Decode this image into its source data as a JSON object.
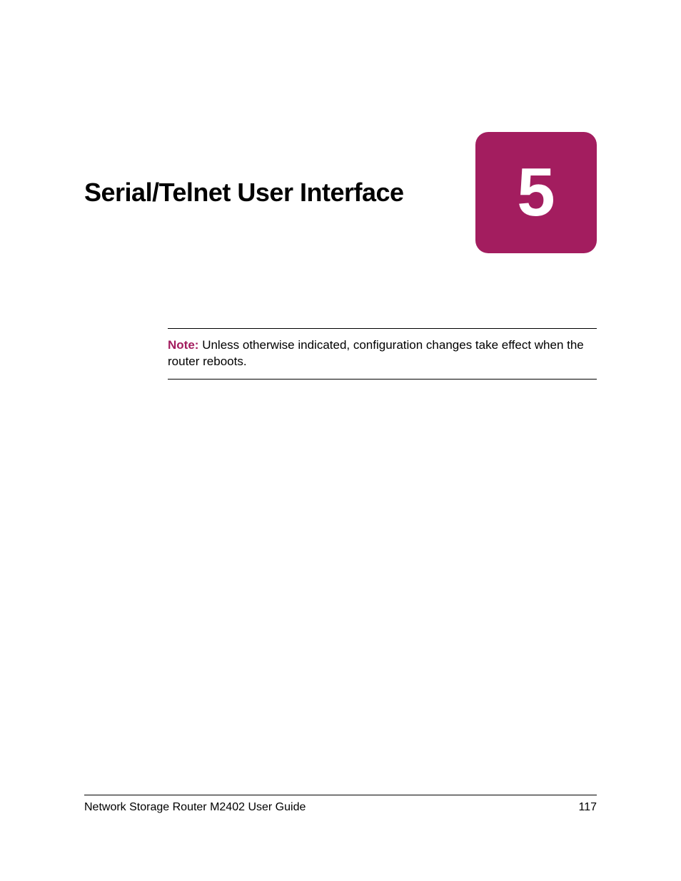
{
  "chapter": {
    "title": "Serial/Telnet User Interface",
    "number": "5"
  },
  "note": {
    "label": "Note:",
    "text": "Unless otherwise indicated, configuration changes take effect when the router reboots."
  },
  "footer": {
    "guide_title": "Network Storage Router M2402 User Guide",
    "page_number": "117"
  }
}
